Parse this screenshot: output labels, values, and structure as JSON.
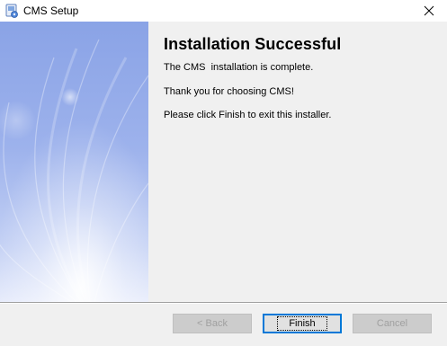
{
  "window": {
    "title": "CMS Setup",
    "icon": "installer-icon",
    "close_icon": "close-icon"
  },
  "content": {
    "heading": "Installation Successful",
    "line1": "The CMS  installation is complete.",
    "line2": "Thank you for choosing CMS!",
    "line3": "Please click Finish to exit this installer."
  },
  "buttons": {
    "back_label": "< Back",
    "finish_label": "Finish",
    "cancel_label": "Cancel"
  },
  "colors": {
    "side_panel_light": "#eef2fc",
    "side_panel_dark": "#8aa3e6",
    "default_button_border": "#0078d7"
  }
}
